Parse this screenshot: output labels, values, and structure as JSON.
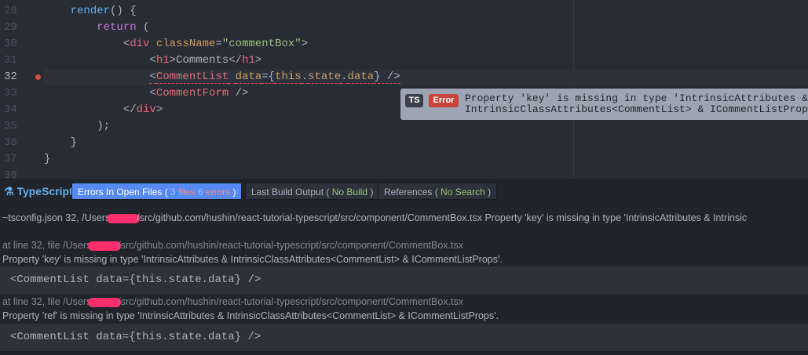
{
  "editor": {
    "lines": [
      {
        "n": "28",
        "tokens": [
          [
            "p",
            "    "
          ],
          [
            "fn",
            "render"
          ],
          [
            "p",
            "() {"
          ]
        ]
      },
      {
        "n": "29",
        "tokens": [
          [
            "p",
            "        "
          ],
          [
            "kw",
            "return"
          ],
          [
            "p",
            " ("
          ]
        ]
      },
      {
        "n": "30",
        "tokens": [
          [
            "p",
            "            <"
          ],
          [
            "tag",
            "div"
          ],
          [
            "p",
            " "
          ],
          [
            "attr",
            "className"
          ],
          [
            "p",
            "="
          ],
          [
            "str",
            "\"commentBox\""
          ],
          [
            "p",
            ">"
          ]
        ]
      },
      {
        "n": "31",
        "tokens": [
          [
            "p",
            "                <"
          ],
          [
            "tag",
            "h1"
          ],
          [
            "p",
            ">Comments</"
          ],
          [
            "tag",
            "h1"
          ],
          [
            "p",
            ">"
          ]
        ]
      },
      {
        "n": "32",
        "current": true,
        "error": true,
        "tokens": [
          [
            "p",
            "                "
          ],
          [
            "p",
            "<"
          ],
          [
            "tag",
            "CommentList"
          ],
          [
            "p",
            " "
          ],
          [
            "attr",
            "data"
          ],
          [
            "p",
            "={"
          ],
          [
            "attr",
            "this"
          ],
          [
            "p",
            "."
          ],
          [
            "attr",
            "state"
          ],
          [
            "p",
            "."
          ],
          [
            "attr",
            "data"
          ],
          [
            "p",
            "} />"
          ]
        ]
      },
      {
        "n": "33",
        "tokens": [
          [
            "p",
            "                <"
          ],
          [
            "tag",
            "CommentForm"
          ],
          [
            "p",
            " />"
          ]
        ]
      },
      {
        "n": "34",
        "tokens": [
          [
            "p",
            "            </"
          ],
          [
            "tag",
            "div"
          ],
          [
            "p",
            ">"
          ]
        ]
      },
      {
        "n": "35",
        "tokens": [
          [
            "p",
            "        );"
          ]
        ]
      },
      {
        "n": "36",
        "tokens": [
          [
            "p",
            "    }"
          ]
        ]
      },
      {
        "n": "37",
        "tokens": [
          [
            "p",
            "}"
          ]
        ]
      },
      {
        "n": "38",
        "tokens": []
      }
    ]
  },
  "tooltip": {
    "ts_badge": "TS",
    "error_badge": "Error",
    "line1": "Property 'key' is missing in type 'IntrinsicAttributes &",
    "line2": "IntrinsicClassAttributes<CommentList> & ICommentListProps'."
  },
  "panel": {
    "title": "TypeScript",
    "tabs": [
      {
        "label": "Errors In Open Files (",
        "n1": "3",
        "w1": "files",
        "n2": "6",
        "w2": "errors",
        "end": ")"
      },
      {
        "label": "Last Build Output (",
        "status": "No Build",
        "end": ")"
      },
      {
        "label": "References (",
        "status": "No Search",
        "end": ")"
      }
    ],
    "summary_pre": "~tsconfig.json 32, /Users",
    "summary_post": "/src/github.com/hushin/react-tutorial-typescript/src/component/CommentBox.tsx Property 'key' is missing in type 'IntrinsicAttributes & Intrinsic",
    "errors": [
      {
        "loc_pre": "at line 32, file /Users",
        "loc_post": "/src/github.com/hushin/react-tutorial-typescript/src/component/CommentBox.tsx",
        "message": "Property 'key' is missing in type 'IntrinsicAttributes & IntrinsicClassAttributes<CommentList> & ICommentListProps'.",
        "code": "<CommentList data={this.state.data} />"
      },
      {
        "loc_pre": "at line 32, file /Users",
        "loc_post": "/src/github.com/hushin/react-tutorial-typescript/src/component/CommentBox.tsx",
        "message": "Property 'ref' is missing in type 'IntrinsicAttributes & IntrinsicClassAttributes<CommentList> & ICommentListProps'.",
        "code": "<CommentList data={this.state.data} />"
      }
    ]
  }
}
